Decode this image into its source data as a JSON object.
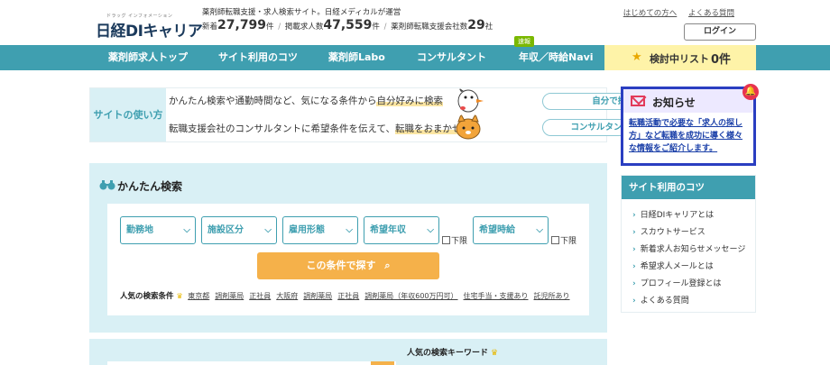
{
  "header": {
    "logo_ruby": "ドラッグ インフォメーション",
    "logo_text_prefix": "日経",
    "logo_text_di": "DI",
    "logo_text_suffix": "キャリア",
    "tagline": "薬剤師転職支援・求人検索サイト。日経メディカルが運営",
    "stats": {
      "new_label": "新着",
      "new_count": "27,799",
      "new_unit": "件",
      "listed_label": "掲載求人数",
      "listed_count": "47,559",
      "listed_unit": "件",
      "companies_label": "薬剤師転職支援会社数",
      "companies_count": "29",
      "companies_unit": "社",
      "separator": "/"
    },
    "links": [
      "はじめての方へ",
      "よくある質問"
    ],
    "login_label": "ログイン"
  },
  "nav": {
    "items": [
      "薬剤師求人トップ",
      "サイト利用のコツ",
      "薬剤師Labo",
      "コンサルタント",
      "年収／時給Navi"
    ],
    "badge": "速報",
    "favorites_label": "検討中リスト",
    "favorites_count": "0件"
  },
  "howto": {
    "title": "サイトの使い方",
    "row1_text_a": "かんたん検索や通勤時間など、気になる条件から",
    "row1_text_hl": "自分好みに検索",
    "row1_button": "自分で探す",
    "row2_text_a": "転職支援会社のコンサルタントに希望条件を伝えて、",
    "row2_text_hl": "転職をおまかせ",
    "row2_button": "コンサルタントに相談"
  },
  "notice": {
    "title": "お知らせ",
    "body": "転職活動で必要な「求人の探し方」など転職を成功に導く様々な情報をご紹介します。"
  },
  "search": {
    "title": "かんたん検索",
    "selects": [
      "勤務地",
      "施設区分",
      "雇用形態",
      "希望年収",
      "希望時給"
    ],
    "checkbox_label": "下限",
    "button_label": "この条件で探す",
    "popular_label": "人気の検索条件",
    "popular_keywords": [
      "東京都",
      "調剤薬局",
      "正社員",
      "大阪府",
      "調剤薬局",
      "正社員",
      "調剤薬局（年収600万円可）",
      "住宅手当・支援あり",
      "託児所あり"
    ]
  },
  "lower": {
    "keywords_title": "人気の検索キーワード"
  },
  "tips": {
    "title": "サイト利用のコツ",
    "items": [
      "日経DIキャリアとは",
      "スカウトサービス",
      "新着求人お知らせメッセージ",
      "希望求人メールとは",
      "プロフィール登録とは",
      "よくある質問"
    ]
  },
  "colors": {
    "accent": "#3f9fb0",
    "nav_bg": "#3f9fb0",
    "search_bg": "#d9f0f5",
    "button_orange": "#f5b14a",
    "favorites_bg": "#fef3a8",
    "notice_border": "#2a3ec1",
    "bell": "#e8334f"
  }
}
